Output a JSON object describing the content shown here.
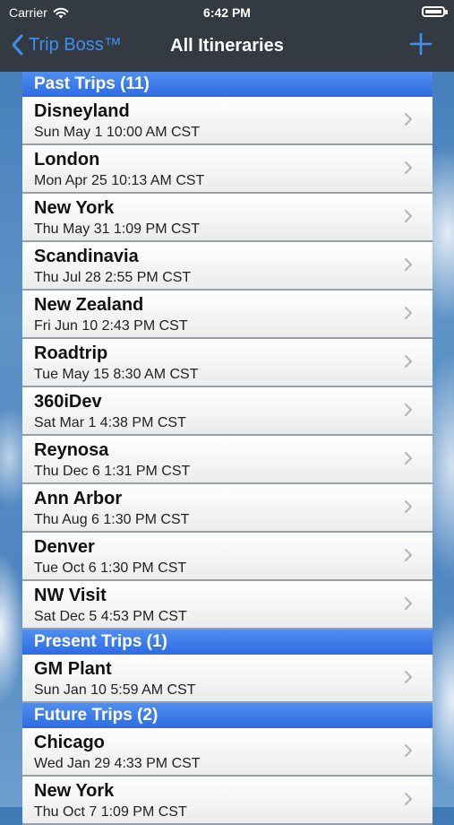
{
  "status": {
    "carrier": "Carrier",
    "time": "6:42 PM"
  },
  "nav": {
    "back_label": "Trip Boss™",
    "title": "All Itineraries"
  },
  "sections": [
    {
      "header": "Past Trips (11)",
      "items": [
        {
          "name": "Disneyland",
          "date": "Sun May 1 10:00 AM CST"
        },
        {
          "name": "London",
          "date": "Mon Apr 25 10:13 AM CST"
        },
        {
          "name": "New York",
          "date": "Thu May 31 1:09 PM CST"
        },
        {
          "name": "Scandinavia",
          "date": "Thu Jul 28 2:55 PM CST"
        },
        {
          "name": "New Zealand",
          "date": "Fri Jun 10 2:43 PM CST"
        },
        {
          "name": "Roadtrip",
          "date": "Tue May 15 8:30 AM CST"
        },
        {
          "name": "360iDev",
          "date": "Sat Mar 1 4:38 PM CST"
        },
        {
          "name": "Reynosa",
          "date": "Thu Dec 6 1:31 PM CST"
        },
        {
          "name": "Ann Arbor",
          "date": "Thu Aug 6 1:30 PM CST"
        },
        {
          "name": "Denver",
          "date": "Tue Oct 6 1:30 PM CST"
        },
        {
          "name": "NW Visit",
          "date": "Sat Dec 5 4:53 PM CST"
        }
      ]
    },
    {
      "header": "Present Trips (1)",
      "items": [
        {
          "name": "GM Plant",
          "date": "Sun Jan 10 5:59 AM CST"
        }
      ]
    },
    {
      "header": "Future Trips (2)",
      "items": [
        {
          "name": "Chicago",
          "date": "Wed Jan 29 4:33 PM CST"
        },
        {
          "name": "New York",
          "date": "Thu Oct 7 1:09 PM CST"
        }
      ]
    }
  ],
  "colors": {
    "nav_bg": "#343a42",
    "accent": "#3d8ff0",
    "section_header": "#2f6be2"
  },
  "icons": {
    "back": "chevron-left-icon",
    "add": "plus-icon",
    "disclosure": "chevron-right-icon",
    "wifi": "wifi-icon",
    "battery": "battery-icon"
  }
}
